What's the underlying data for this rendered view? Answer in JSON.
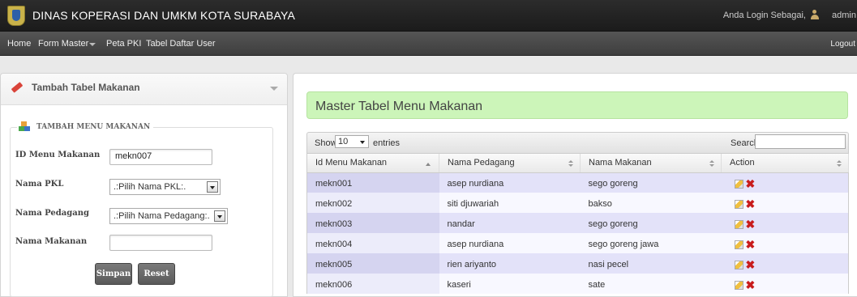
{
  "header": {
    "title": "DINAS KOPERASI DAN UMKM KOTA SURABAYA",
    "login_text": "Anda Login Sebagai,",
    "username": "admin"
  },
  "nav": {
    "home": "Home",
    "form_master": "Form Master",
    "peta_pkl": "Peta PKI",
    "tabel_daftar_user": "Tabel Daftar User",
    "logout": "Logout"
  },
  "form_panel": {
    "title": "Tambah Tabel Makanan",
    "legend": "TAMBAH MENU MAKANAN",
    "id_label": "ID Menu Makanan",
    "id_value": "mekn007",
    "pkl_label": "Nama PKL",
    "pkl_select": ".:Pilih Nama PKL:.",
    "pedagang_label": "Nama Pedagang",
    "pedagang_select": ".:Pilih Nama Pedagang:.",
    "makanan_label": "Nama Makanan",
    "makanan_value": "",
    "simpan": "Simpan",
    "reset": "Reset"
  },
  "table_panel": {
    "title": "Master Tabel Menu Makanan",
    "show": "Show",
    "length": "10",
    "entries": "entries",
    "search": "Search:",
    "columns": [
      "Id Menu Makanan",
      "Nama Pedagang",
      "Nama Makanan",
      "Action"
    ],
    "rows": [
      {
        "id": "mekn001",
        "pedagang": "asep nurdiana",
        "makanan": "sego goreng"
      },
      {
        "id": "mekn002",
        "pedagang": "siti djuwariah",
        "makanan": "bakso"
      },
      {
        "id": "mekn003",
        "pedagang": "nandar",
        "makanan": "sego goreng"
      },
      {
        "id": "mekn004",
        "pedagang": "asep nurdiana",
        "makanan": "sego goreng jawa"
      },
      {
        "id": "mekn005",
        "pedagang": "rien ariyanto",
        "makanan": "nasi pecel"
      },
      {
        "id": "mekn006",
        "pedagang": "kaseri",
        "makanan": "sate"
      }
    ]
  },
  "colors": {
    "title_bg": "#ccf5b9",
    "row_odd": "#e3e2f9",
    "row_even": "#f8f8ff",
    "topbar": "#1b1b1b",
    "delete_icon": "#c81c1c"
  }
}
